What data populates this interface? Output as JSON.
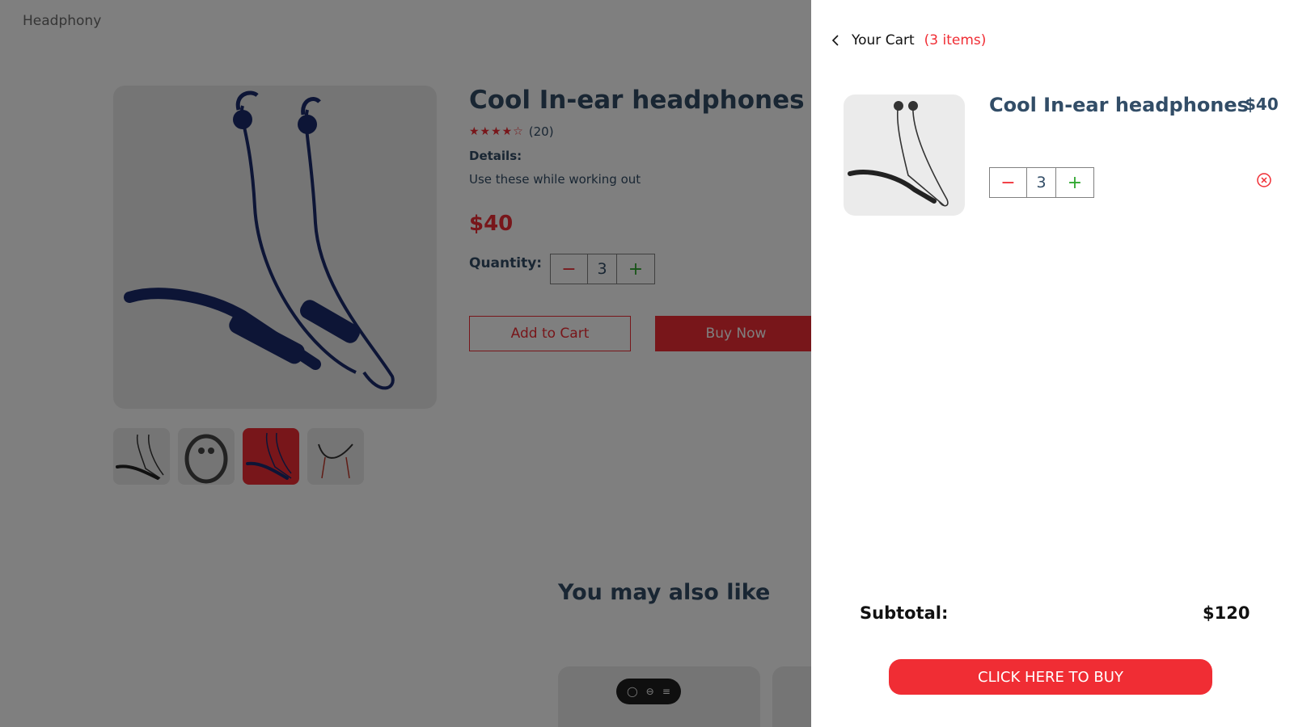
{
  "brand": {
    "logo_text": "Headphony"
  },
  "product": {
    "title": "Cool In-ear headphones",
    "stars": "★★★★☆",
    "rating_count": "(20)",
    "details_label": "Details:",
    "details_text": "Use these while working out",
    "price": "$40",
    "quantity_label": "Quantity:",
    "quantity": "3",
    "add_to_cart_label": "Add to Cart",
    "buy_now_label": "Buy Now",
    "thumbnail_count": 4,
    "active_thumbnail": 3
  },
  "recommendations": {
    "heading": "You may also like"
  },
  "cart": {
    "heading": "Your Cart",
    "count_label": "(3 items)",
    "items": [
      {
        "name": "Cool In-ear headphones",
        "price": "$40",
        "quantity": "3"
      }
    ],
    "subtotal_label": "Subtotal:",
    "subtotal_value": "$120",
    "checkout_label": "CLICK HERE TO BUY"
  },
  "colors": {
    "accent": "#f02d34",
    "text": "#324d67",
    "plus": "#31a831",
    "image_bg": "#ebebeb",
    "overlay": "rgba(0,0,0,0.5)"
  },
  "icons": {
    "back": "chevron-left-icon",
    "remove": "circle-x-icon",
    "minus": "minus-icon",
    "plus": "plus-icon",
    "star": "star-icon"
  }
}
